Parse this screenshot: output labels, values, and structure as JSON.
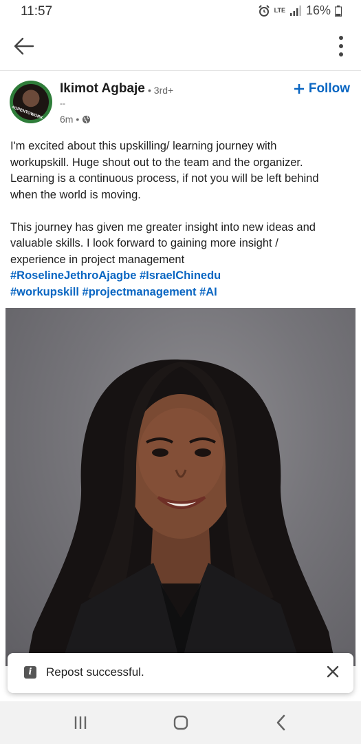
{
  "status_bar": {
    "time": "11:57",
    "network": "LTE",
    "battery": "16%"
  },
  "post": {
    "author": {
      "name": "Ikimot Agbaje",
      "degree": "• 3rd+",
      "subtitle": "--",
      "avatar_badge_text": "#OPENTOWORK"
    },
    "time_ago": "6m •",
    "follow_label": "Follow",
    "body": {
      "line1": "I'm excited about this upskilling/ learning journey with",
      "line2": "workupskill. Huge shout out to the team and the organizer.",
      "line3": "Learning is a continuous process, if not you will be left behind",
      "line4": "when the world is moving.",
      "line5": "This journey has given me greater insight into new ideas and",
      "line6": "valuable skills. I look forward to gaining more insight /",
      "line7": "experience in project management"
    },
    "hashtags": {
      "line1": "#RoselineJethroAjagbe #IsraelChinedu",
      "line2": "#workupskill #projectmanagement #AI"
    }
  },
  "toast": {
    "message": "Repost successful."
  },
  "icons": {
    "back": "arrow-left-icon",
    "more": "more-vertical-icon",
    "globe": "globe-icon",
    "info": "info-icon",
    "close": "close-icon"
  },
  "colors": {
    "accent": "#0a66c2",
    "open_to_work_green": "#2f7d3a"
  }
}
